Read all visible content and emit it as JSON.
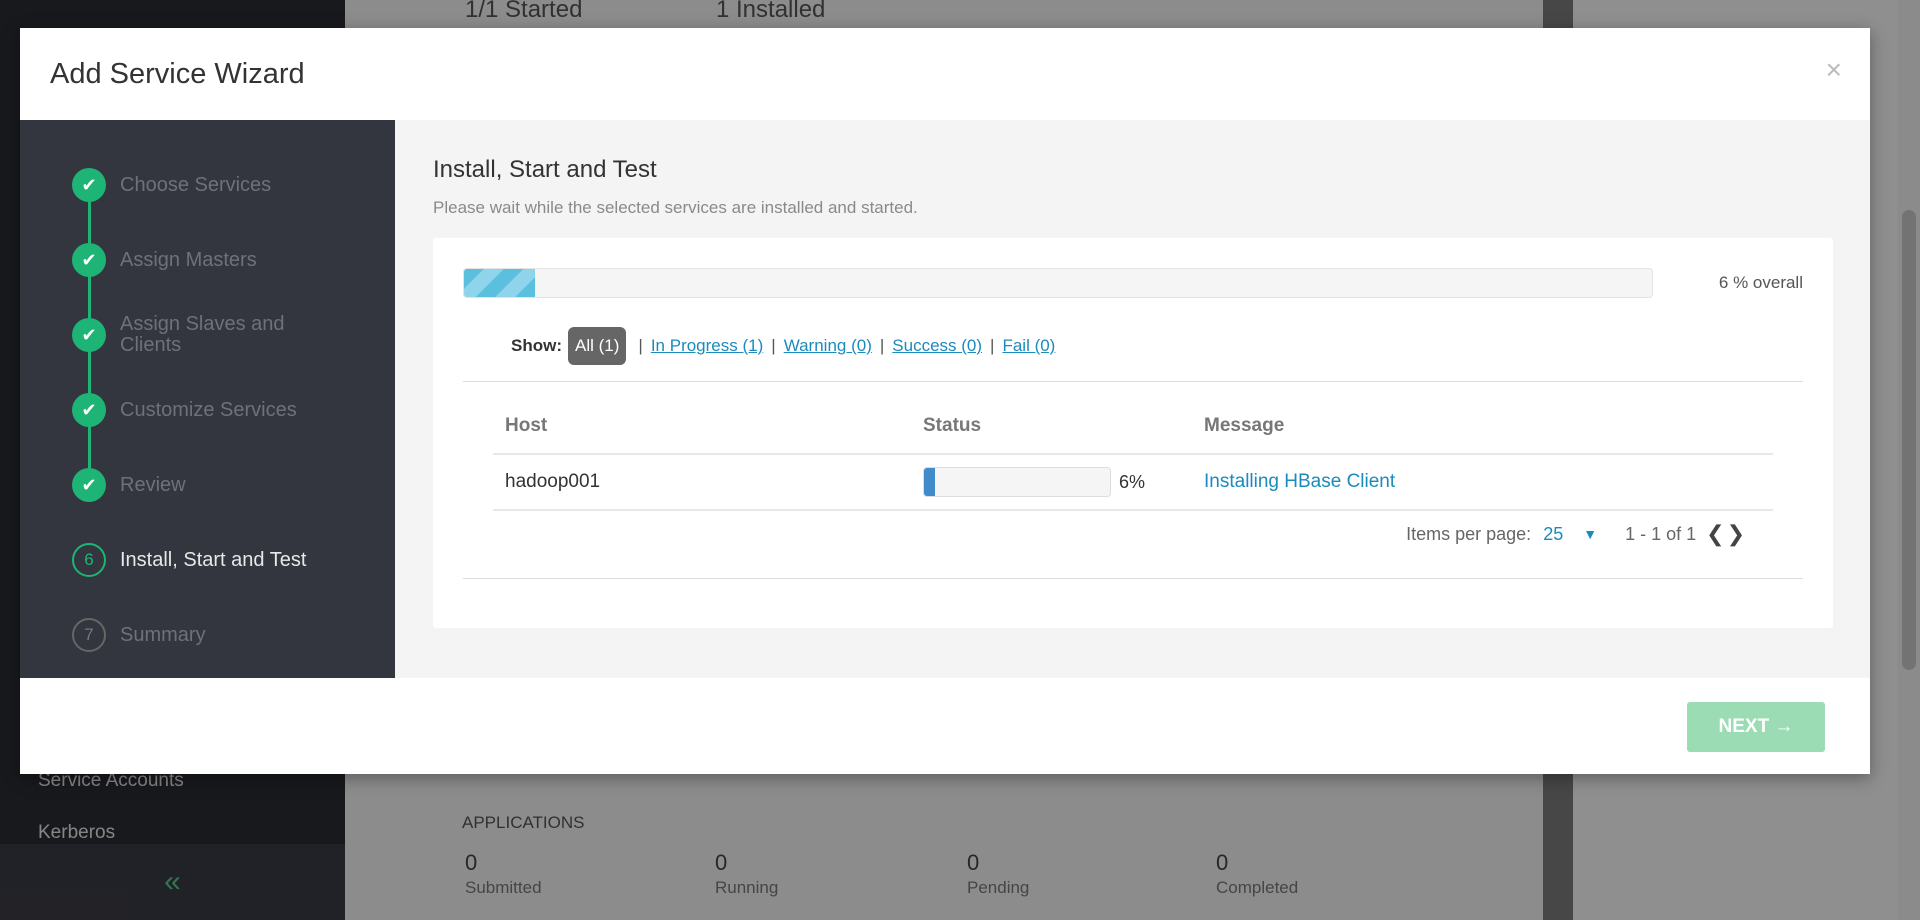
{
  "background": {
    "top_stats": [
      "1/1 Started",
      "1 Installed"
    ],
    "sidebar_links": [
      "Service Accounts",
      "Kerberos"
    ],
    "collapse_glyph": "«",
    "applications": {
      "heading": "APPLICATIONS",
      "stats": [
        {
          "value": "0",
          "label": "Submitted"
        },
        {
          "value": "0",
          "label": "Running"
        },
        {
          "value": "0",
          "label": "Pending"
        },
        {
          "value": "0",
          "label": "Completed"
        }
      ]
    }
  },
  "modal": {
    "title": "Add Service Wizard",
    "close_glyph": "×"
  },
  "steps": [
    {
      "marker": "✔",
      "label": "Choose Services",
      "state": "done"
    },
    {
      "marker": "✔",
      "label": "Assign Masters",
      "state": "done"
    },
    {
      "marker": "✔",
      "label": "Assign Slaves and Clients",
      "state": "done"
    },
    {
      "marker": "✔",
      "label": "Customize Services",
      "state": "done"
    },
    {
      "marker": "✔",
      "label": "Review",
      "state": "done"
    },
    {
      "marker": "6",
      "label": "Install, Start and Test",
      "state": "current"
    },
    {
      "marker": "7",
      "label": "Summary",
      "state": "future"
    }
  ],
  "content": {
    "title": "Install, Start and Test",
    "subtitle": "Please wait while the selected services are installed and started.",
    "overall_progress_percent": 6,
    "overall_label": "6 % overall",
    "filters": {
      "show_label": "Show:",
      "all": "All (1)",
      "in_progress": "In Progress (1)",
      "warning": "Warning (0)",
      "success": "Success (0)",
      "fail": "Fail (0)",
      "separator": "|"
    },
    "table": {
      "headers": {
        "host": "Host",
        "status": "Status",
        "message": "Message"
      },
      "rows": [
        {
          "host": "hadoop001",
          "progress_percent": 6,
          "progress_label": "6%",
          "message": "Installing HBase Client"
        }
      ]
    },
    "pager": {
      "items_per_page_label": "Items per page:",
      "items_per_page_value": "25",
      "caret": "▼",
      "range": "1 - 1 of 1",
      "prev": "❮",
      "next": "❯"
    }
  },
  "footer": {
    "next_label": "NEXT →"
  }
}
